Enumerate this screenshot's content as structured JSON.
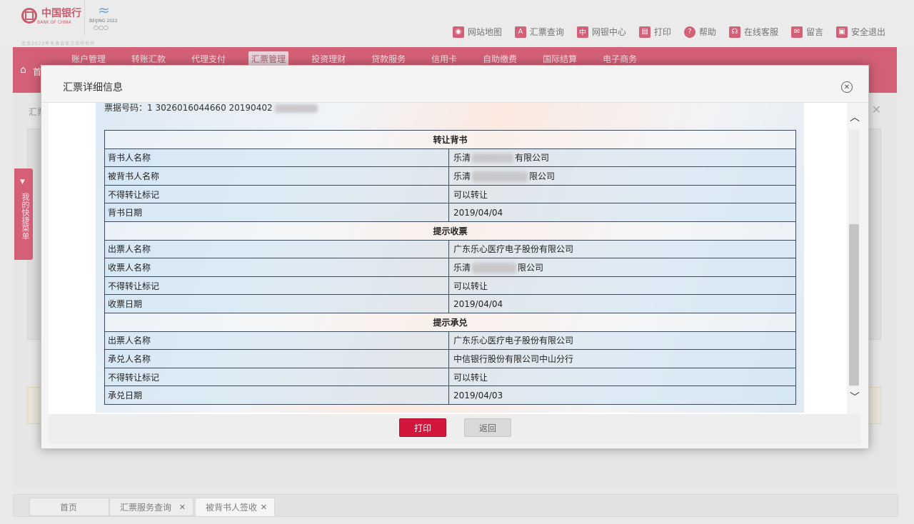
{
  "header": {
    "bank_name": "中国银行",
    "bank_sub": "BANK OF CHINA",
    "slogan": "北京2022年冬奥会官方合作伙伴",
    "olympic_text": "BEIJING 2022",
    "links": [
      {
        "label": "网站地图",
        "icon": "map-icon"
      },
      {
        "label": "汇票查询",
        "icon": "query-icon"
      },
      {
        "label": "网银中心",
        "icon": "center-icon"
      },
      {
        "label": "打印",
        "icon": "print-icon"
      },
      {
        "label": "帮助",
        "icon": "help-icon"
      },
      {
        "label": "在线客服",
        "icon": "service-icon"
      },
      {
        "label": "留言",
        "icon": "message-icon"
      },
      {
        "label": "安全退出",
        "icon": "lock-icon"
      }
    ]
  },
  "nav": {
    "home_label": "首页",
    "items": [
      "账户管理",
      "转账汇款",
      "代理支付",
      "汇票管理",
      "投资理财",
      "贷款服务",
      "信用卡",
      "自助缴费",
      "国际结算",
      "电子商务"
    ],
    "active_index": 3
  },
  "background": {
    "panel_title": "汇票",
    "side_tab_label": "我的快捷菜单"
  },
  "dialog": {
    "title": "汇票详细信息",
    "top_line": "票据号码：1 3026016044660 20190402",
    "sections": [
      {
        "title": "转让背书",
        "rows": [
          {
            "label": "背书人名称",
            "value_prefix": "乐清",
            "value_suffix": "有限公司",
            "blurred": true
          },
          {
            "label": "被背书人名称",
            "value_prefix": "乐清",
            "value_suffix": "限公司",
            "blurred": true
          },
          {
            "label": "不得转让标记",
            "value_prefix": "可以转让",
            "value_suffix": "",
            "blurred": false
          },
          {
            "label": "背书日期",
            "value_prefix": "2019/04/04",
            "value_suffix": "",
            "blurred": false
          }
        ]
      },
      {
        "title": "提示收票",
        "rows": [
          {
            "label": "出票人名称",
            "value_prefix": "广东乐心医疗电子股份有限公司",
            "value_suffix": "",
            "blurred": false
          },
          {
            "label": "收票人名称",
            "value_prefix": "乐清",
            "value_suffix": "限公司",
            "blurred": true
          },
          {
            "label": "不得转让标记",
            "value_prefix": "可以转让",
            "value_suffix": "",
            "blurred": false
          },
          {
            "label": "收票日期",
            "value_prefix": "2019/04/04",
            "value_suffix": "",
            "blurred": false
          }
        ]
      },
      {
        "title": "提示承兑",
        "rows": [
          {
            "label": "出票人名称",
            "value_prefix": "广东乐心医疗电子股份有限公司",
            "value_suffix": "",
            "blurred": false
          },
          {
            "label": "承兑人名称",
            "value_prefix": "中信银行股份有限公司中山分行",
            "value_suffix": "",
            "blurred": false
          },
          {
            "label": "不得转让标记",
            "value_prefix": "可以转让",
            "value_suffix": "",
            "blurred": false
          },
          {
            "label": "承兑日期",
            "value_prefix": "2019/04/03",
            "value_suffix": "",
            "blurred": false
          }
        ]
      }
    ],
    "print_button": "打印",
    "back_button": "返回"
  },
  "bottom_tabs": [
    {
      "label": "首页",
      "closable": false
    },
    {
      "label": "汇票服务查询",
      "closable": true
    },
    {
      "label": "被背书人签收",
      "closable": true
    }
  ]
}
